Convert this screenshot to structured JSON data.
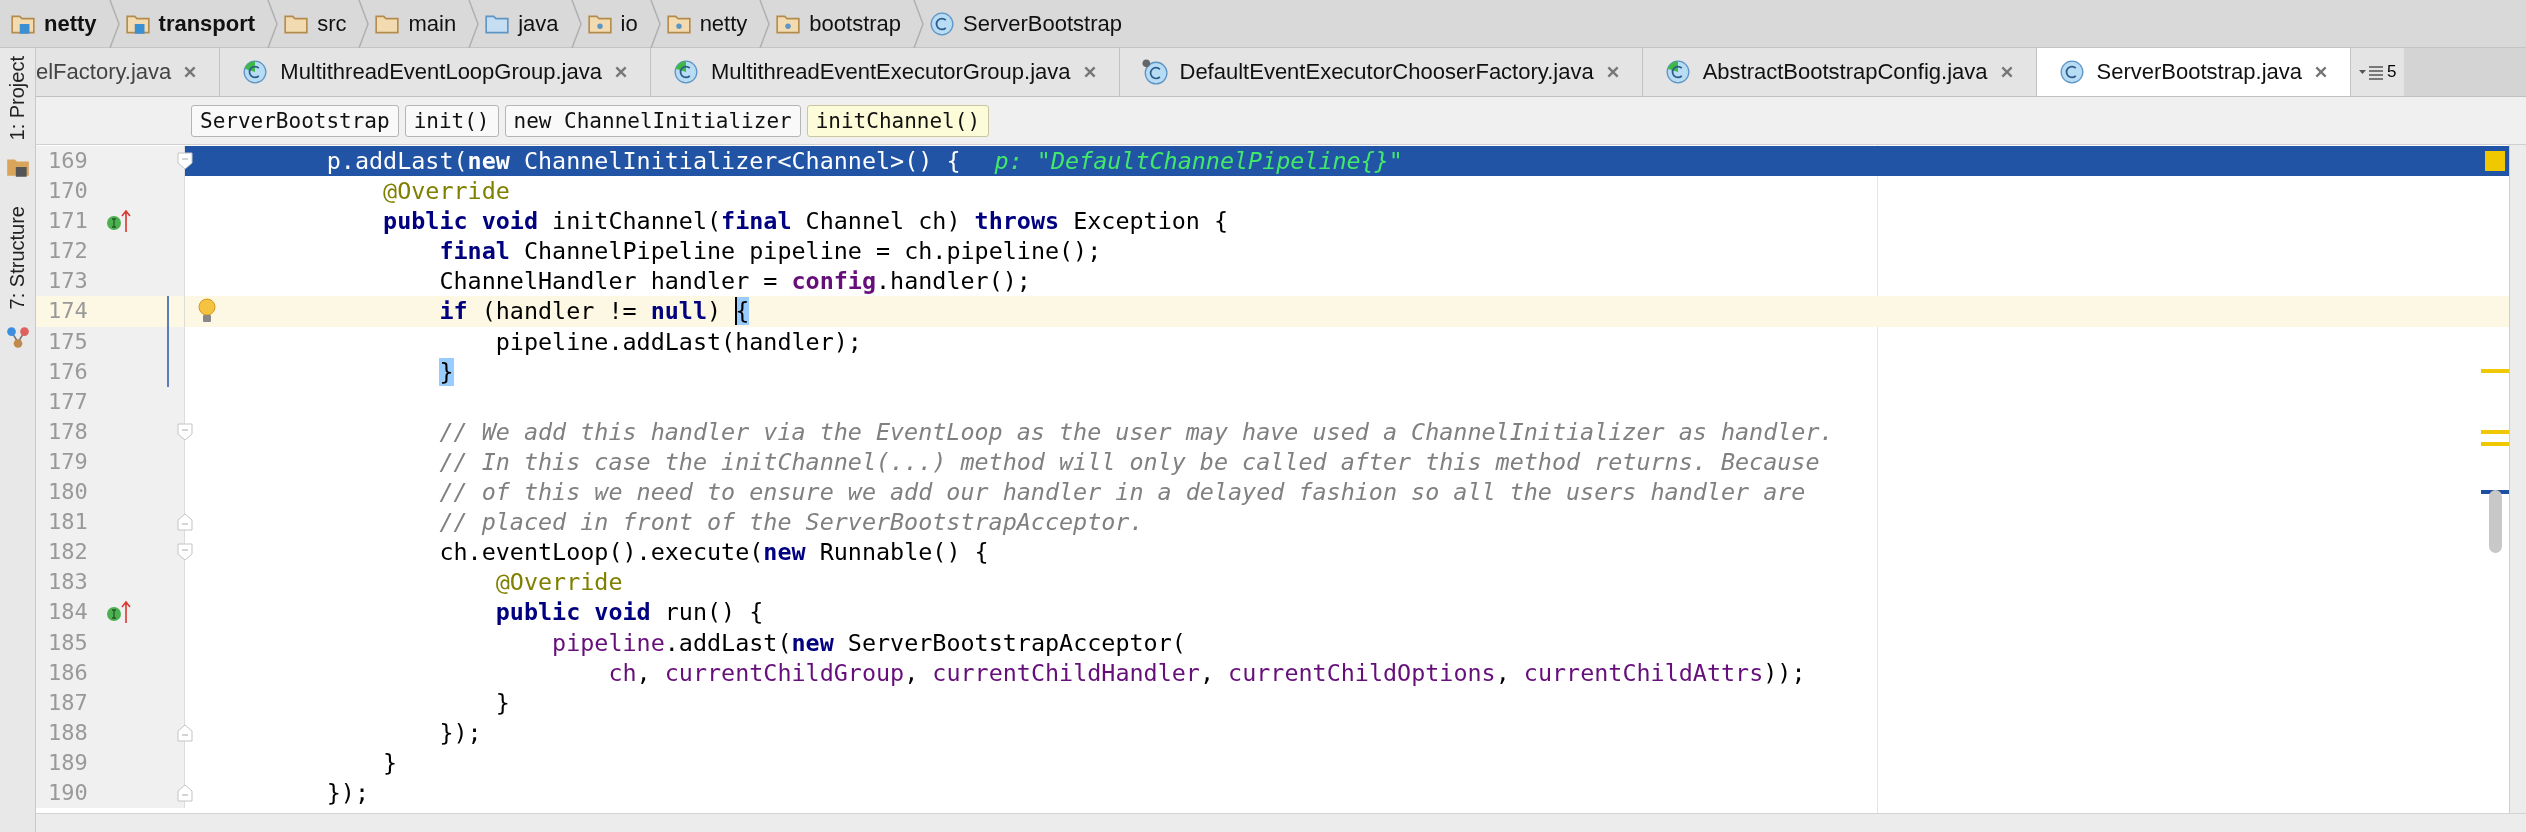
{
  "breadcrumbs": [
    {
      "label": "netty",
      "kind": "module"
    },
    {
      "label": "transport",
      "kind": "module"
    },
    {
      "label": "src",
      "kind": "folder"
    },
    {
      "label": "main",
      "kind": "folder"
    },
    {
      "label": "java",
      "kind": "source-root"
    },
    {
      "label": "io",
      "kind": "package"
    },
    {
      "label": "netty",
      "kind": "package"
    },
    {
      "label": "bootstrap",
      "kind": "package"
    },
    {
      "label": "ServerBootstrap",
      "kind": "class"
    }
  ],
  "tool_windows": [
    {
      "label": "1: Project",
      "kind": "project"
    },
    {
      "label": "7: Structure",
      "kind": "structure"
    }
  ],
  "tabs": [
    {
      "label": "elFactory.java",
      "selected": false
    },
    {
      "label": "MultithreadEventLoopGroup.java",
      "kind": "partial",
      "selected": false
    },
    {
      "label": "MultithreadEventExecutorGroup.java",
      "kind": "partial",
      "selected": false
    },
    {
      "label": "DefaultEventExecutorChooserFactory.java",
      "kind": "pinned",
      "selected": false
    },
    {
      "label": "AbstractBootstrapConfig.java",
      "kind": "partial",
      "selected": false
    },
    {
      "label": "ServerBootstrap.java",
      "kind": "plain",
      "selected": true
    }
  ],
  "tab_overflow": {
    "count": "5"
  },
  "structure_path": [
    {
      "label": "ServerBootstrap",
      "selected": false
    },
    {
      "label": "init()",
      "selected": false
    },
    {
      "label": "new ChannelInitializer",
      "selected": false
    },
    {
      "label": "initChannel()",
      "selected": true
    }
  ],
  "lines": [
    {
      "number": "169",
      "selected": true,
      "current": false,
      "fold_start": true,
      "tokens": [
        {
          "text": "p.addLast(",
          "kind": "plain"
        },
        {
          "text": "new",
          "kind": "keyword"
        },
        {
          "text": " ChannelInitializer<Channel>() {",
          "kind": "plain"
        }
      ],
      "hint": "p: \"DefaultChannelPipeline{}\"",
      "children": [
        {
          "number": "170",
          "selected": false,
          "current": false,
          "tokens": [
            {
              "text": "@Override",
              "kind": "annotation"
            }
          ]
        },
        {
          "number": "171",
          "selected": false,
          "current": false,
          "implements": true,
          "tokens": [
            {
              "text": "public void",
              "kind": "keyword"
            },
            {
              "text": " initChannel(",
              "kind": "plain"
            },
            {
              "text": "final",
              "kind": "keyword"
            },
            {
              "text": " Channel ch) ",
              "kind": "plain"
            },
            {
              "text": "throws",
              "kind": "keyword"
            },
            {
              "text": " Exception {",
              "kind": "plain"
            }
          ],
          "children": [
            {
              "number": "172",
              "selected": false,
              "current": false,
              "tokens": [
                {
                  "text": "final",
                  "kind": "keyword"
                },
                {
                  "text": " ChannelPipeline pipeline = ch.pipeline();",
                  "kind": "plain"
                }
              ]
            },
            {
              "number": "173",
              "selected": false,
              "current": false,
              "tokens": [
                {
                  "text": "ChannelHandler handler = ",
                  "kind": "plain"
                },
                {
                  "text": "config",
                  "kind": "bold-field"
                },
                {
                  "text": ".handler();",
                  "kind": "plain"
                }
              ]
            },
            {
              "number": "174",
              "selected": false,
              "current": true,
              "changed": true,
              "intention": true,
              "tokens": [
                {
                  "text": "if",
                  "kind": "keyword"
                },
                {
                  "text": " (handler != ",
                  "kind": "plain"
                },
                {
                  "text": "null",
                  "kind": "keyword"
                },
                {
                  "text": ") ",
                  "kind": "plain"
                },
                {
                  "text": "{",
                  "kind": "match"
                }
              ],
              "children": [
                {
                  "number": "175",
                  "selected": false,
                  "current": false,
                  "changed": true,
                  "tokens": [
                    {
                      "text": "pipeline.addLast(handler);",
                      "kind": "plain"
                    }
                  ]
                }
              ]
            },
            {
              "number": "176",
              "selected": false,
              "current": false,
              "changed": true,
              "tokens": [
                {
                  "text": "}",
                  "kind": "match"
                }
              ]
            },
            {
              "number": "177",
              "selected": false,
              "current": false
            },
            {
              "number": "178",
              "selected": false,
              "current": false,
              "fold_start": true,
              "tokens": [
                {
                  "text": "// We add this handler via the EventLoop as the user may have used a ChannelInitializer as handler.",
                  "kind": "comment"
                }
              ]
            },
            {
              "number": "179",
              "selected": false,
              "current": false,
              "tokens": [
                {
                  "text": "// In this case the initChannel(...) method will only be called after this method returns. Because",
                  "kind": "comment"
                }
              ]
            },
            {
              "number": "180",
              "selected": false,
              "current": false,
              "tokens": [
                {
                  "text": "// of this we need to ensure we add our handler in a delayed fashion so all the users handler are",
                  "kind": "comment"
                }
              ]
            },
            {
              "number": "181",
              "selected": false,
              "current": false,
              "fold_end": true,
              "tokens": [
                {
                  "text": "// placed in front of the ServerBootstrapAcceptor.",
                  "kind": "comment"
                }
              ]
            },
            {
              "number": "182",
              "selected": false,
              "current": false,
              "fold_start": true,
              "tokens": [
                {
                  "text": "ch.eventLoop().execute(",
                  "kind": "plain"
                },
                {
                  "text": "new",
                  "kind": "keyword"
                },
                {
                  "text": " Runnable() {",
                  "kind": "plain"
                }
              ],
              "children": [
                {
                  "number": "183",
                  "selected": false,
                  "current": false,
                  "tokens": [
                    {
                      "text": "@Override",
                      "kind": "annotation"
                    }
                  ]
                },
                {
                  "number": "184",
                  "selected": false,
                  "current": false,
                  "implements": true,
                  "tokens": [
                    {
                      "text": "public void",
                      "kind": "keyword"
                    },
                    {
                      "text": " run() {",
                      "kind": "plain"
                    }
                  ],
                  "children": [
                    {
                      "number": "185",
                      "selected": false,
                      "current": false,
                      "tokens": [
                        {
                          "text": "pipeline",
                          "kind": "field"
                        },
                        {
                          "text": ".addLast(",
                          "kind": "plain"
                        },
                        {
                          "text": "new",
                          "kind": "keyword"
                        },
                        {
                          "text": " ServerBootstrapAcceptor(",
                          "kind": "plain"
                        }
                      ],
                      "children": [
                        {
                          "number": "186",
                          "selected": false,
                          "current": false,
                          "tokens": [
                            {
                              "text": "ch",
                              "kind": "field"
                            },
                            {
                              "text": ", ",
                              "kind": "plain"
                            },
                            {
                              "text": "currentChildGroup",
                              "kind": "field"
                            },
                            {
                              "text": ", ",
                              "kind": "plain"
                            },
                            {
                              "text": "currentChildHandler",
                              "kind": "field"
                            },
                            {
                              "text": ", ",
                              "kind": "plain"
                            },
                            {
                              "text": "currentChildOptions",
                              "kind": "field"
                            },
                            {
                              "text": ", ",
                              "kind": "plain"
                            },
                            {
                              "text": "currentChildAttrs",
                              "kind": "field"
                            },
                            {
                              "text": "));",
                              "kind": "plain"
                            }
                          ]
                        }
                      ]
                    }
                  ]
                },
                {
                  "number": "187",
                  "selected": false,
                  "current": false,
                  "tokens": [
                    {
                      "text": "}",
                      "kind": "plain"
                    }
                  ]
                }
              ]
            },
            {
              "number": "188",
              "selected": false,
              "current": false,
              "fold_end": true,
              "tokens": [
                {
                  "text": "});",
                  "kind": "plain"
                }
              ]
            }
          ]
        },
        {
          "number": "189",
          "selected": false,
          "current": false,
          "tokens": [
            {
              "text": "}",
              "kind": "plain"
            }
          ]
        }
      ]
    },
    {
      "number": "190",
      "selected": false,
      "current": false,
      "fold_end": true,
      "tokens": [
        {
          "text": "});",
          "kind": "plain"
        }
      ]
    }
  ]
}
